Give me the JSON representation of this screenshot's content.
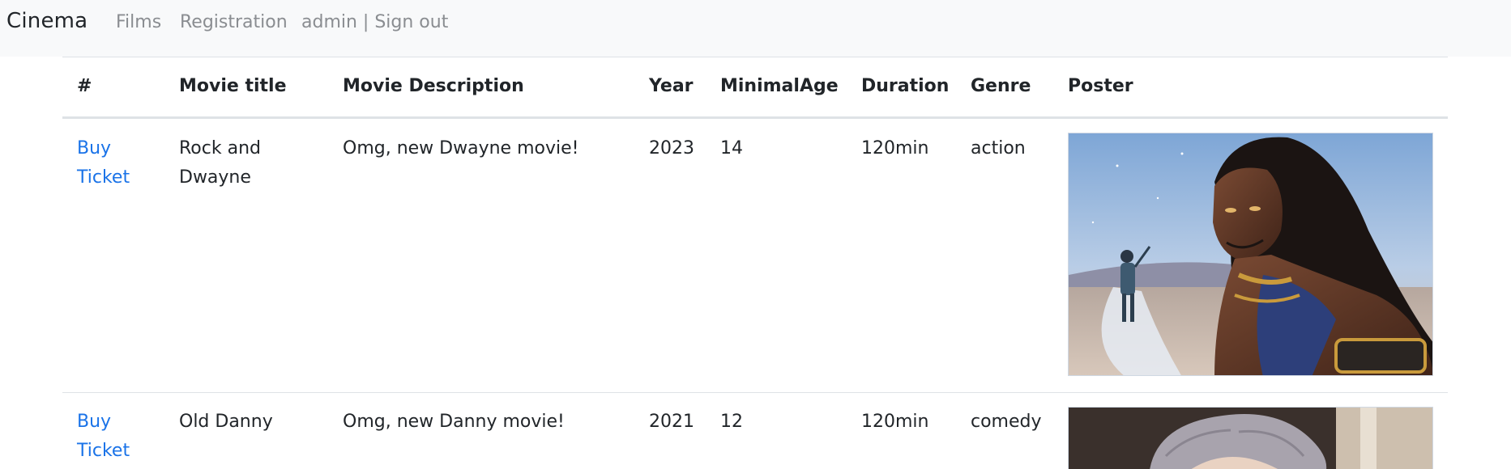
{
  "navbar": {
    "brand": "Cinema",
    "links": [
      "Films",
      "Registration",
      "admin | Sign out"
    ]
  },
  "table": {
    "headers": [
      "#",
      "Movie title",
      "Movie Description",
      "Year",
      "MinimalAge",
      "Duration",
      "Genre",
      "Poster"
    ],
    "rows": [
      {
        "action": "Buy Ticket",
        "title": "Rock and Dwayne",
        "description": "Omg, new Dwayne movie!",
        "year": "2023",
        "minimal_age": "14",
        "duration": "120min",
        "genre": "action",
        "poster_icon": "poster-image"
      },
      {
        "action": "Buy Ticket",
        "title": "Old Danny",
        "description": "Omg, new Danny movie!",
        "year": "2021",
        "minimal_age": "12",
        "duration": "120min",
        "genre": "comedy",
        "poster_icon": "poster-image"
      }
    ]
  },
  "colors": {
    "navbar_bg": "#f8f9fa",
    "link": "#1a73e8",
    "nav_muted": "#8a8d91",
    "border": "#dee2e6"
  }
}
